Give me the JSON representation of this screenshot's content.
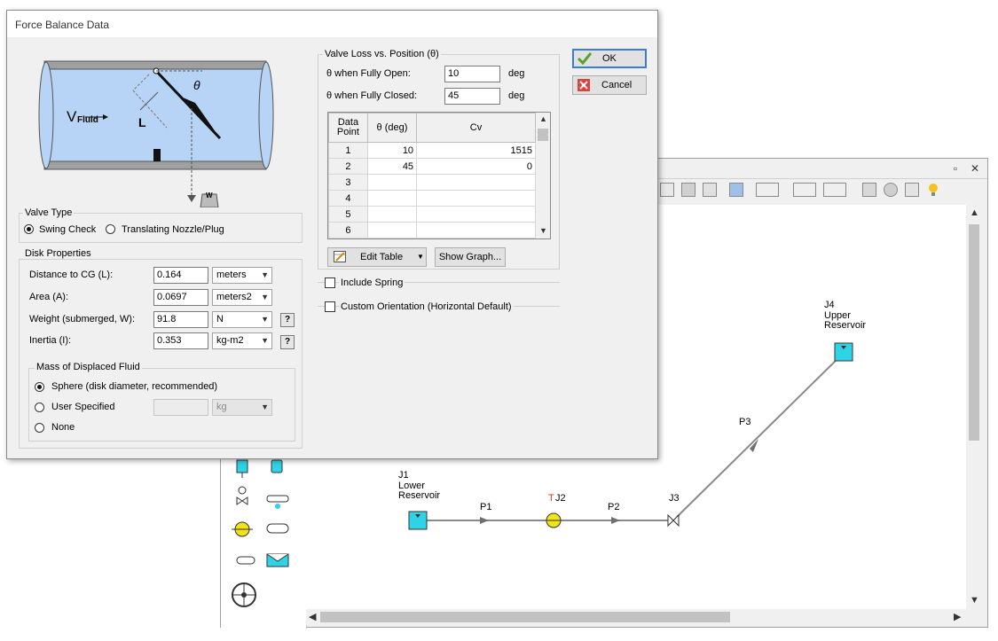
{
  "background_app": {
    "nodes": [
      {
        "id": "J1",
        "name": "Lower\nReservoir"
      },
      {
        "id": "J2",
        "name": ""
      },
      {
        "id": "J3",
        "name": ""
      },
      {
        "id": "J4",
        "name": "Upper\nReservoir"
      }
    ],
    "j2_prefix": "T",
    "pipes": [
      "P1",
      "P2",
      "P3"
    ],
    "window_buttons": {
      "restore": "▫",
      "close": "✕"
    }
  },
  "dialog": {
    "title": "Force Balance Data",
    "diagram": {
      "theta": "θ",
      "l": "L",
      "v": "V",
      "v_sub": "Fluid",
      "w": "W"
    },
    "valve_type": {
      "group_label": "Valve Type",
      "options": [
        "Swing Check",
        "Translating Nozzle/Plug"
      ],
      "selected": "Swing Check"
    },
    "disk": {
      "group_label": "Disk Properties",
      "rows": [
        {
          "label": "Distance to CG (L):",
          "value": "0.164",
          "unit": "meters",
          "help": false
        },
        {
          "label": "Area (A):",
          "value": "0.0697",
          "unit": "meters2",
          "help": false
        },
        {
          "label": "Weight (submerged, W):",
          "value": "91.8",
          "unit": "N",
          "help": true
        },
        {
          "label": "Inertia (I):",
          "value": "0.353",
          "unit": "kg-m2",
          "help": true
        }
      ],
      "help_label": "?",
      "mass": {
        "group_label": "Mass of Displaced Fluid",
        "options": [
          "Sphere (disk diameter, recommended)",
          "User Specified",
          "None"
        ],
        "selected": "Sphere (disk diameter, recommended)",
        "user_value": "",
        "user_unit": "kg"
      }
    },
    "valve_loss": {
      "group_label": "Valve Loss vs. Position (θ)",
      "open_label": "θ when Fully Open:",
      "open_value": "10",
      "closed_label": "θ when Fully Closed:",
      "closed_value": "45",
      "unit": "deg",
      "table": {
        "headers": [
          "Data\nPoint",
          "θ (deg)",
          "Cv"
        ],
        "rows": [
          {
            "n": "1",
            "theta": "10",
            "cv": "1515"
          },
          {
            "n": "2",
            "theta": "45",
            "cv": "0"
          },
          {
            "n": "3",
            "theta": "",
            "cv": ""
          },
          {
            "n": "4",
            "theta": "",
            "cv": ""
          },
          {
            "n": "5",
            "theta": "",
            "cv": ""
          },
          {
            "n": "6",
            "theta": "",
            "cv": ""
          }
        ]
      },
      "edit_table": "Edit Table",
      "show_graph": "Show Graph..."
    },
    "include_spring": "Include Spring",
    "custom_orientation": "Custom Orientation (Horizontal Default)",
    "ok": "OK",
    "cancel": "Cancel"
  },
  "colors": {
    "water": "#b7d3f5",
    "node_fill": "#2fd3e8",
    "pump": "#f2e318",
    "accent": "#3d7bd6"
  }
}
